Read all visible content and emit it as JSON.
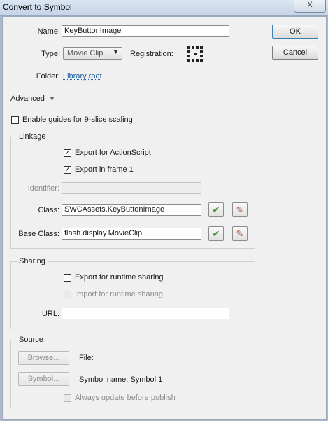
{
  "window": {
    "title": "Convert to Symbol",
    "close_label": "X"
  },
  "buttons": {
    "ok": "OK",
    "cancel": "Cancel"
  },
  "form": {
    "name_label": "Name:",
    "name_value": "KeyButtonImage",
    "type_label": "Type:",
    "type_value": "Movie Clip",
    "registration_label": "Registration:",
    "folder_label": "Folder:",
    "folder_link": "Library root",
    "advanced_label": "Advanced",
    "nine_slice_label": "Enable guides for 9-slice scaling"
  },
  "linkage": {
    "title": "Linkage",
    "export_actionscript": "Export for ActionScript",
    "export_frame1": "Export in frame 1",
    "identifier_label": "Identifier:",
    "identifier_value": "",
    "class_label": "Class:",
    "class_value": "SWCAssets.KeyButtonImage",
    "base_class_label": "Base Class:",
    "base_class_value": "flash.display.MovieClip"
  },
  "sharing": {
    "title": "Sharing",
    "export_runtime": "Export for runtime sharing",
    "import_runtime": "Import for runtime sharing",
    "url_label": "URL:",
    "url_value": ""
  },
  "source": {
    "title": "Source",
    "browse_label": "Browse...",
    "file_label": "File:",
    "symbol_label": "Symbol...",
    "symbol_name": "Symbol name: Symbol 1",
    "always_update": "Always update before publish"
  },
  "colors": {
    "accent_link": "#1f5fa8",
    "check_green": "#3c9a2c"
  },
  "icons": {
    "validate": "checkmark-icon",
    "edit": "pencil-icon",
    "registration": "registration-grid-icon",
    "advanced_toggle": "triangle-down-icon"
  }
}
